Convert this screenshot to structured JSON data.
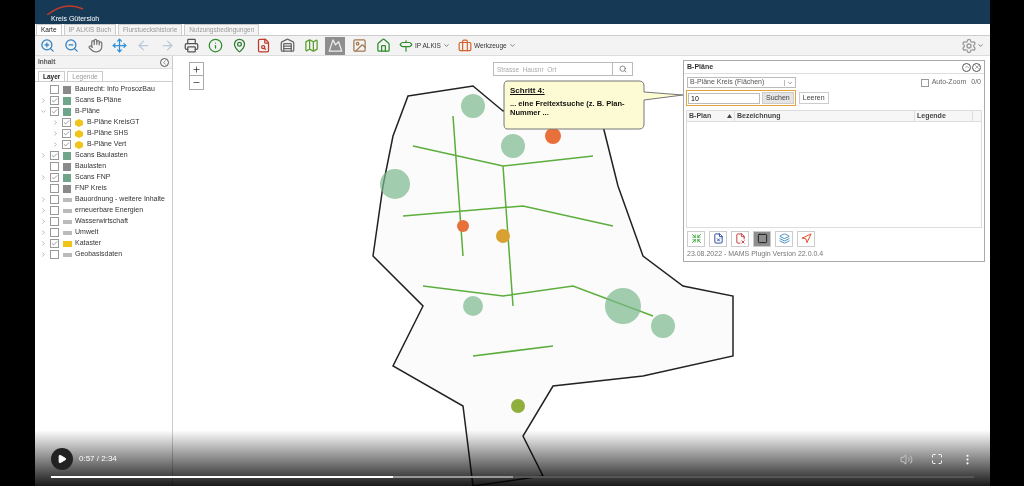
{
  "header": {
    "logo_text": "Kreis Gütersloh"
  },
  "tabs": [
    {
      "label": "Karte",
      "selected": true
    },
    {
      "label": "IP ALKIS Buch",
      "selected": false
    },
    {
      "label": "Flurstueckshistorie",
      "selected": false
    },
    {
      "label": "Nutzungsbedingungen",
      "selected": false
    }
  ],
  "toolbar": {
    "tools": [
      {
        "selected": false
      },
      {
        "selected": false
      },
      {
        "selected": false
      },
      {
        "selected": false
      },
      {
        "selected": false
      },
      {
        "selected": false
      },
      {
        "selected": false
      },
      {
        "selected": false
      },
      {
        "selected": false
      },
      {
        "selected": false
      },
      {
        "selected": false
      },
      {
        "selected": false
      },
      {
        "selected": true
      },
      {
        "selected": false
      },
      {
        "selected": false
      }
    ],
    "menus": [
      {
        "label": "IP ALKIS",
        "kind": "signpost"
      },
      {
        "label": "Werkzeuge",
        "kind": "toolbox"
      }
    ]
  },
  "sidebar": {
    "title": "Inhalt",
    "tabs": [
      {
        "label": "Layer",
        "selected": true
      },
      {
        "label": "Legende",
        "selected": false
      }
    ],
    "layers": [
      {
        "label": "Baurecht: Info ProsozBau",
        "checked": false,
        "kind": "raster"
      },
      {
        "label": "Scans B-Pläne",
        "checked": true,
        "expanded": false,
        "kind": "raster"
      },
      {
        "label": "B-Pläne",
        "checked": true,
        "expanded": true,
        "kind": "raster",
        "children": [
          {
            "label": "B-Pläne KreisGT",
            "checked": true,
            "expanded": false,
            "kind": "hexagon"
          },
          {
            "label": "B-Pläne SHS",
            "checked": true,
            "expanded": false,
            "kind": "hexagon"
          },
          {
            "label": "B-Pläne Vert",
            "checked": true,
            "expanded": false,
            "kind": "hexagon"
          }
        ]
      },
      {
        "label": "Scans Baulasten",
        "checked": true,
        "expanded": false,
        "kind": "raster"
      },
      {
        "label": "Baulasten",
        "checked": false,
        "kind": "raster"
      },
      {
        "label": "Scans FNP",
        "checked": true,
        "expanded": false,
        "kind": "raster"
      },
      {
        "label": "FNP Kreis",
        "checked": false,
        "kind": "raster"
      },
      {
        "label": "Bauordnung - weitere Inhalte",
        "checked": false,
        "expanded": false,
        "kind": "group"
      },
      {
        "label": "erneuerbare Energien",
        "checked": false,
        "expanded": false,
        "kind": "group"
      },
      {
        "label": "Wasserwirtschaft",
        "checked": false,
        "expanded": false,
        "kind": "group"
      },
      {
        "label": "Umwelt",
        "checked": false,
        "expanded": false,
        "kind": "group"
      },
      {
        "label": "Kataster",
        "checked": true,
        "expanded": false,
        "kind": "folder"
      },
      {
        "label": "Geobasisdaten",
        "checked": false,
        "expanded": false,
        "kind": "group"
      }
    ]
  },
  "map": {
    "search": {
      "placeholder": "Strasse  Hausnr  Ort"
    },
    "callout": {
      "title": "Schritt 4:",
      "text": "... eine Freitextsuche (z. B. Plan-Nummer ..."
    }
  },
  "panel": {
    "title": "B-Pläne",
    "layer_select": "B-Pläne Kreis (Flächen)",
    "auto_zoom": {
      "label": "Auto-Zoom",
      "checked": false
    },
    "count": "0/0",
    "query": "10",
    "search_highlighted": true,
    "search_button": "Suchen",
    "clear_button": "Leeren",
    "table": {
      "columns": [
        {
          "label": "B-Plan",
          "sorted": true
        },
        {
          "label": "Bezeichnung",
          "sorted": false
        },
        {
          "label": "Legende",
          "sorted": false
        }
      ]
    },
    "tools": [
      {
        "selected": false
      },
      {
        "selected": false
      },
      {
        "selected": false
      },
      {
        "selected": true
      },
      {
        "selected": false
      },
      {
        "selected": false
      }
    ],
    "footer": "23.08.2022 - MAMS Plugin Version 22.0.0.4"
  },
  "player": {
    "time": "0:57 / 2:34",
    "progress": {
      "level": 0.37
    },
    "buffer": {
      "level": 0.5
    }
  }
}
